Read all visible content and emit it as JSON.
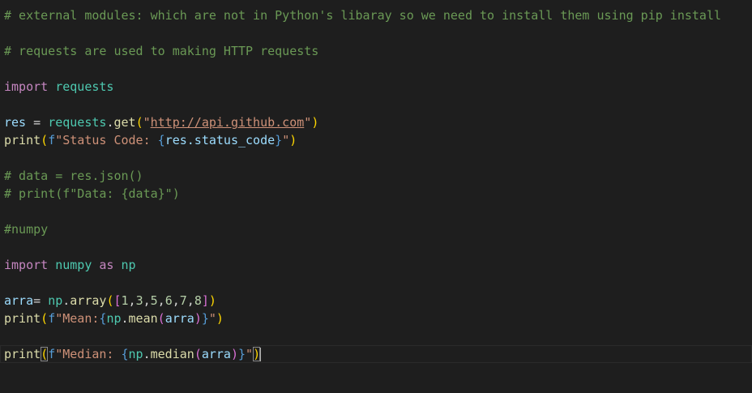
{
  "code": {
    "l1_comment": "# external modules: which are not in Python's libaray so we need to install them using pip install",
    "l3_comment": "# requests are used to making HTTP requests",
    "kw_import": "import",
    "mod_requests": "requests",
    "var_res": "res",
    "op_eq": " = ",
    "fn_get": "get",
    "url": "http://api.github.com",
    "fn_print": "print",
    "f_prefix": "f",
    "str_status": "\"Status Code: ",
    "expr_status": "res.status_code",
    "str_close": "\"",
    "l10_comment": "# data = res.json()",
    "l11_comment": "# print(f\"Data: {data}\")",
    "l13_comment": "#numpy",
    "mod_numpy": "numpy",
    "kw_as": "as",
    "mod_np": "np",
    "var_arra": "arra",
    "op_eq_tight": "= ",
    "fn_array": "array",
    "nums": [
      "1",
      "3",
      "5",
      "6",
      "7",
      "8"
    ],
    "str_mean": "\"Mean:",
    "fn_mean": "mean",
    "str_median": "\"Median: ",
    "fn_median": "median"
  }
}
